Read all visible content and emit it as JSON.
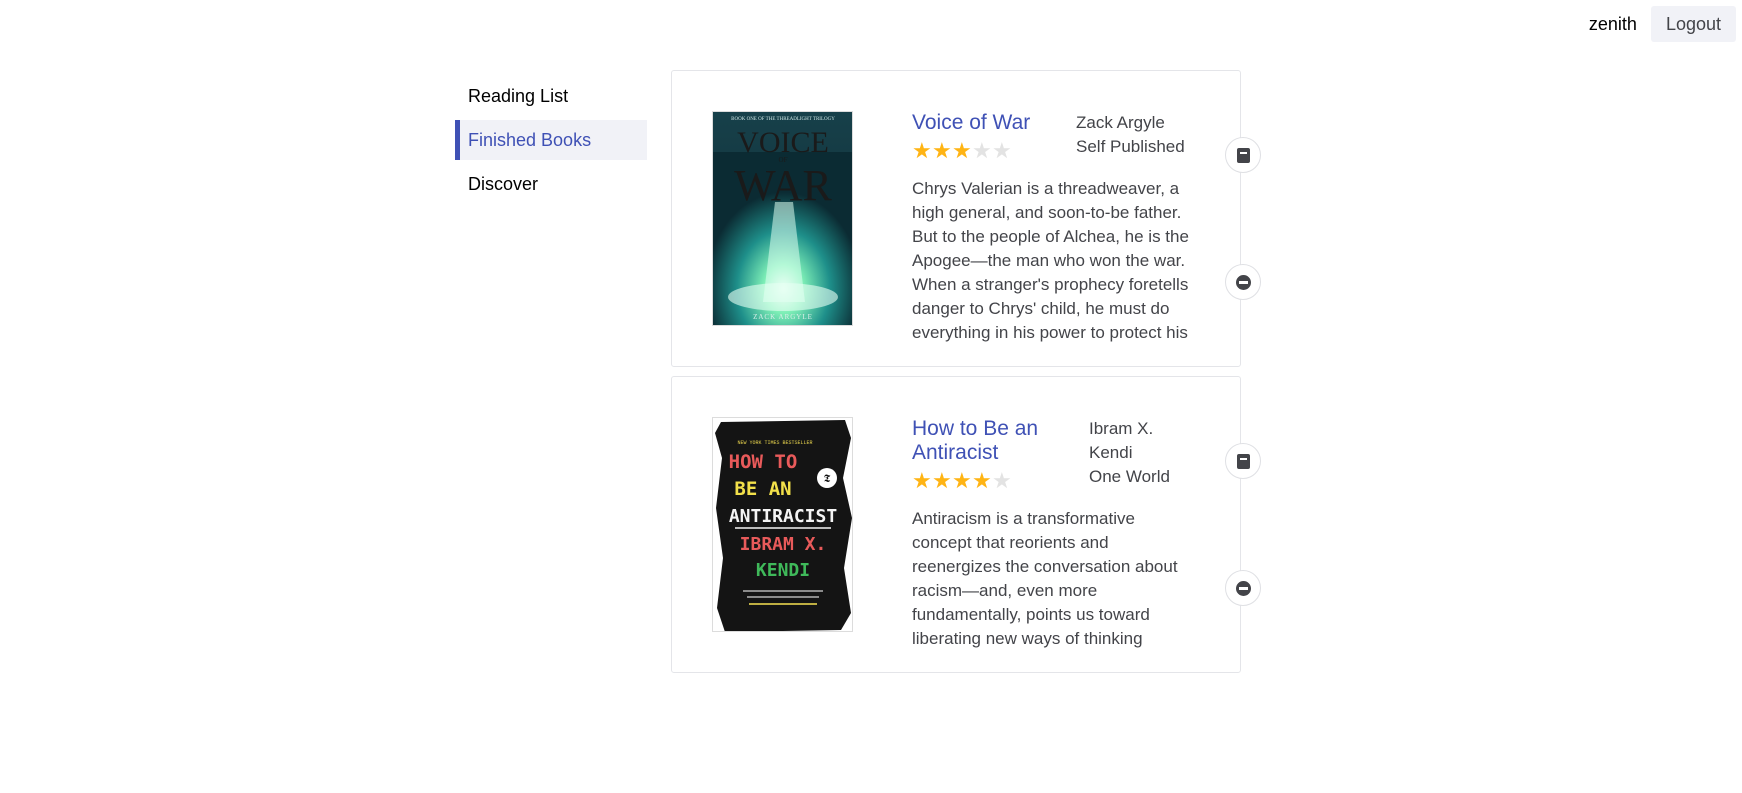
{
  "header": {
    "username": "zenith",
    "logout_label": "Logout"
  },
  "nav": {
    "items": [
      {
        "label": "Reading List",
        "active": false
      },
      {
        "label": "Finished Books",
        "active": true
      },
      {
        "label": "Discover",
        "active": false
      }
    ]
  },
  "books": [
    {
      "title": "Voice of War",
      "author": "Zack Argyle",
      "publisher": "Self Published",
      "rating": 3,
      "max_rating": 5,
      "synopsis": "Chrys Valerian is a threadweaver, a high general, and soon-to-be father. But to the people of Alchea, he is the Apogee—the man who won the war. When a stranger's prophecy foretells danger to Chrys' child, he must do everything in his power to protect his",
      "cover": {
        "series_line": "BOOK ONE OF THE THREADLIGHT TRILOGY",
        "title_line_1": "VOICE",
        "title_line_2": "OF",
        "title_line_3": "WAR",
        "author_line": "ZACK ARGYLE"
      },
      "actions": {
        "primary_icon": "book-icon",
        "secondary_icon": "minus-circle-icon"
      }
    },
    {
      "title": "How to Be an Antiracist",
      "author": "Ibram X. Kendi",
      "publisher": "One World",
      "rating": 4,
      "max_rating": 5,
      "synopsis": "Antiracism is a transformative concept that reorients and reenergizes the conversation about racism—and, even more fundamentally, points us toward liberating new ways of thinking",
      "cover": {
        "banner": "NEW YORK TIMES BESTSELLER",
        "title_line_1": "HOW TO",
        "title_line_2": "BE AN",
        "title_line_3": "ANTIRACIST",
        "author_line_1": "IBRAM X.",
        "author_line_2": "KENDI"
      },
      "actions": {
        "primary_icon": "book-icon",
        "secondary_icon": "minus-circle-icon"
      }
    }
  ],
  "colors": {
    "accent": "#3f51b5",
    "star_on": "#ffb414",
    "star_off": "#e3e3e3",
    "nav_active_bg": "#f1f2f7"
  }
}
